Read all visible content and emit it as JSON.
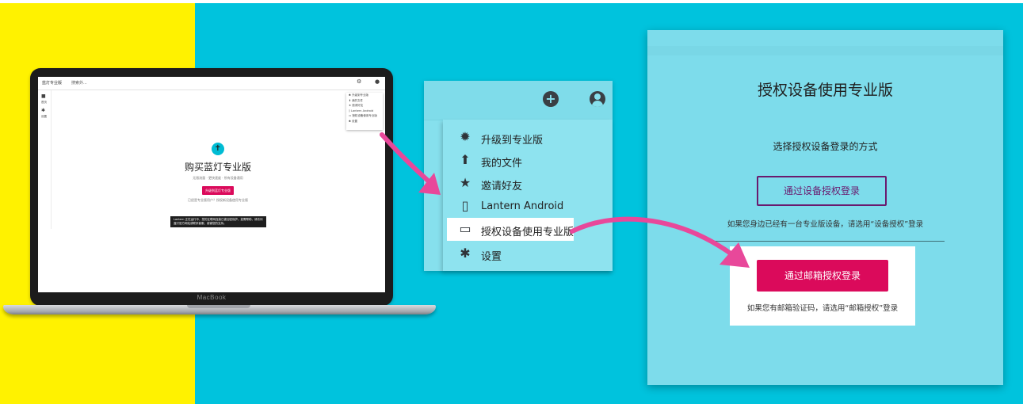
{
  "colors": {
    "background_cyan": "#00c3dd",
    "background_yellow": "#fff200",
    "accent_pink": "#db0a5b",
    "arrow_pink": "#e8489a",
    "outline_purple": "#6a1a6e"
  },
  "laptop": {
    "brand": "MacBook",
    "app": {
      "title": "蓝灯专业版",
      "search_placeholder": "搜索外...",
      "rail_items": [
        "首页",
        "设置"
      ],
      "mini_menu_items": [
        "升级到专业版",
        "我的文件",
        "邀请好友",
        "Lantern Android",
        "授权设备使用专业版",
        "设置"
      ],
      "logo_icon": "lantern-icon",
      "title_text": "购买蓝灯专业版",
      "description": "无限流量 · 更快速度 · 所有设备通用",
      "button_label": "升级到蓝灯专业版",
      "link_text": "已经是专业版用户？授权新设备使用专业版",
      "snackbar_text": "Lantern 正在运行中，您的互联网连接已被加密保护。如需帮助，请访问蓝灯官方网站或联系客服，谢谢您的支持。"
    }
  },
  "menu_panel": {
    "topbar_icons": [
      "add-circle-icon",
      "account-icon"
    ],
    "items": [
      {
        "icon": "badge-icon",
        "label": "升级到专业版"
      },
      {
        "icon": "upload-icon",
        "label": "我的文件"
      },
      {
        "icon": "star-icon",
        "label": "邀请好友"
      },
      {
        "icon": "phone-icon",
        "label": "Lantern Android"
      },
      {
        "icon": "devices-icon",
        "label": "授权设备使用专业版",
        "active": true
      },
      {
        "icon": "gear-icon",
        "label": "设置"
      }
    ]
  },
  "dialog": {
    "title": "授权设备使用专业版",
    "subtitle": "选择授权设备登录的方式",
    "device_button": "通过设备授权登录",
    "device_hint": "如果您身边已经有一台专业版设备，请选用“设备授权”登录",
    "email_button": "通过邮箱授权登录",
    "email_hint": "如果您有邮箱验证码，请选用“邮箱授权”登录"
  }
}
